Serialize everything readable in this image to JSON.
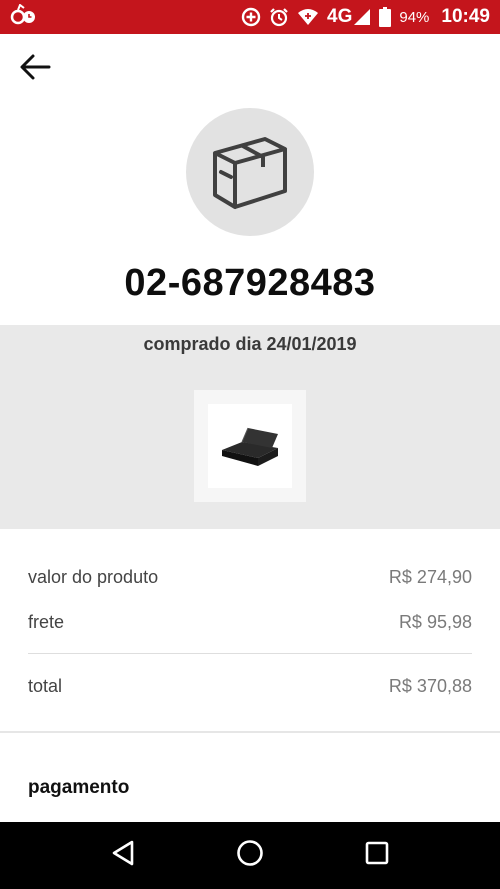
{
  "status_bar": {
    "network_label": "4G",
    "battery_percent": "94%",
    "time": "10:49",
    "icons": [
      "notification-app-icon",
      "data-saver-icon",
      "alarm-icon",
      "wifi-icon",
      "signal-icon",
      "battery-icon"
    ]
  },
  "header": {
    "back_icon": "back-arrow-icon",
    "box_icon": "package-box-icon",
    "order_number": "02-687928483"
  },
  "purchase": {
    "date_text": "comprado dia 24/01/2019",
    "product_image": "product-thumbnail"
  },
  "summary": {
    "rows": [
      {
        "label": "valor do produto",
        "value": "R$ 274,90"
      },
      {
        "label": "frete",
        "value": "R$ 95,98"
      }
    ],
    "total": {
      "label": "total",
      "value": "R$ 370,88"
    }
  },
  "payment": {
    "title": "pagamento"
  },
  "colors": {
    "status_bar": "#c4151c",
    "band": "#e9e9e9",
    "circle": "#e2e2e2"
  }
}
